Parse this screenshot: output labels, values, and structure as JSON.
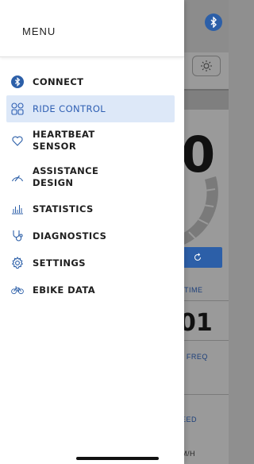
{
  "menu": {
    "title": "MENU",
    "items": [
      {
        "label": "CONNECT",
        "icon": "bluetooth-icon"
      },
      {
        "label": "RIDE CONTROL",
        "icon": "ride-control-icon",
        "active": true
      },
      {
        "label_line1": "HEARTBEAT",
        "label_line2": "SENSOR",
        "icon": "heart-icon"
      },
      {
        "label_line1": "ASSISTANCE",
        "label_line2": "DESIGN",
        "icon": "gauge-icon"
      },
      {
        "label": "STATISTICS",
        "icon": "bar-chart-icon"
      },
      {
        "label": "DIAGNOSTICS",
        "icon": "stethoscope-icon"
      },
      {
        "label": "SETTINGS",
        "icon": "gear-icon"
      },
      {
        "label": "EBIKE DATA",
        "icon": "bike-icon"
      }
    ]
  },
  "background": {
    "speed_fragment": "0",
    "value_fragment": "01",
    "label_time": "TIME",
    "label_freq": "T FREQ",
    "label_speed": "EED",
    "label_unit": "M/H"
  },
  "colors": {
    "accent": "#2f5fb3",
    "active_bg": "#dde8f8",
    "bluetooth": "#2c5fa8"
  }
}
